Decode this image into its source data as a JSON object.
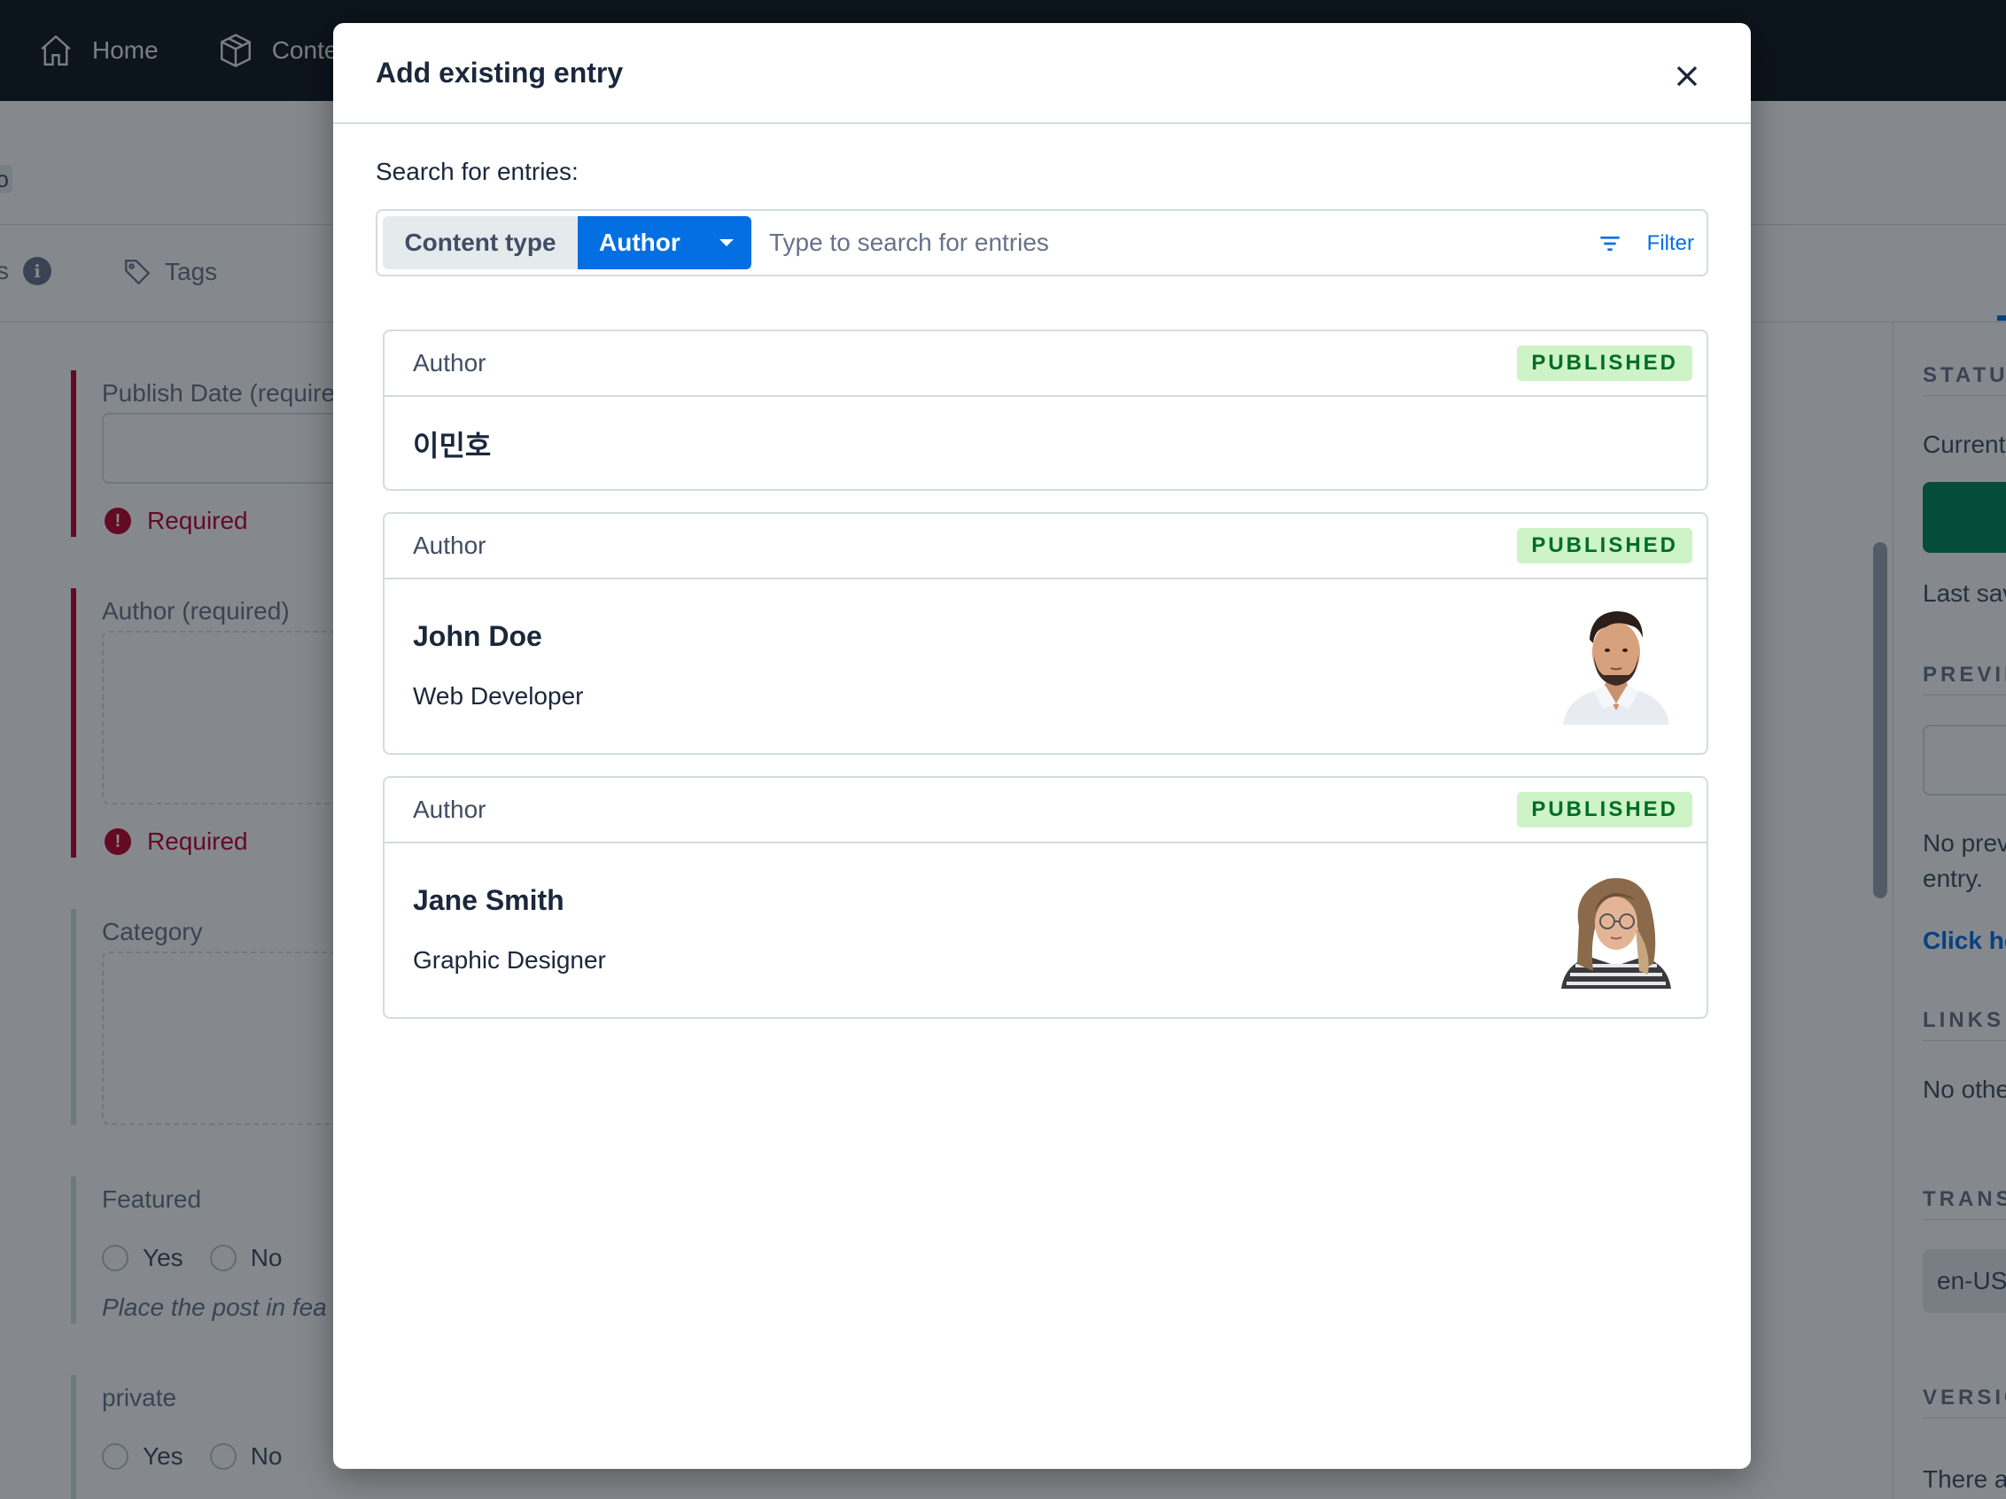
{
  "app": {
    "nav": [
      {
        "label": "Home",
        "icon": "home-icon"
      },
      {
        "label": "Conte",
        "icon": "content-model-icon"
      }
    ],
    "tabs": {
      "cut_label": "s",
      "tags_label": "Tags"
    },
    "subheader_cut": "o",
    "fields": {
      "publish_date": {
        "label": "Publish Date (require",
        "error": "Required"
      },
      "author": {
        "label": "Author (required)",
        "error": "Required"
      },
      "category": {
        "label": "Category"
      },
      "featured": {
        "label": "Featured",
        "yes": "Yes",
        "no": "No",
        "help": "Place the post in fea"
      },
      "private": {
        "label": "private",
        "yes": "Yes",
        "no": "No"
      }
    },
    "sidebar": {
      "status_head": "STATU",
      "current": "Current",
      "last_saved": "Last sav",
      "preview_head": "PREVIE",
      "no_preview_1": "No prev",
      "no_preview_2": "entry.",
      "click_link": "Click he",
      "links_head": "LINKS",
      "no_other": "No othe",
      "trans_head": "TRANS",
      "locale": "en-US",
      "versions_head": "VERSIC",
      "there": "There a"
    }
  },
  "modal": {
    "title": "Add existing entry",
    "search_label": "Search for entries:",
    "content_type_label": "Content type",
    "content_type_value": "Author",
    "search_placeholder": "Type to search for entries",
    "filter_label": "Filter",
    "entries": [
      {
        "type": "Author",
        "status": "PUBLISHED",
        "title": "이민호",
        "description": ""
      },
      {
        "type": "Author",
        "status": "PUBLISHED",
        "title": "John Doe",
        "description": "Web Developer",
        "thumbnail": "man-portrait"
      },
      {
        "type": "Author",
        "status": "PUBLISHED",
        "title": "Jane Smith",
        "description": "Graphic Designer",
        "thumbnail": "woman-portrait"
      }
    ]
  },
  "colors": {
    "accent": "#036fe3",
    "error": "#bd002a",
    "published_bg": "#cdf3c6",
    "published_text": "#006d23",
    "topbar": "#0c141c"
  }
}
